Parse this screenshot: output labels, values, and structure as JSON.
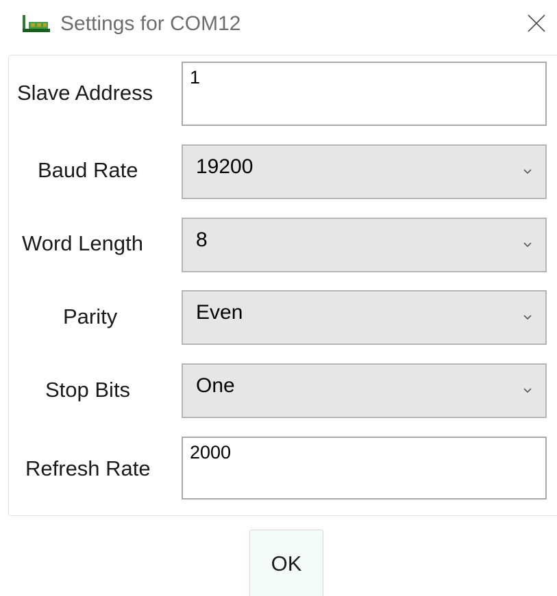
{
  "window": {
    "title": "Settings for COM12",
    "icon": "app-board-icon",
    "close_icon": "close-icon",
    "accent": "#2e7d32"
  },
  "fields": {
    "slave_address": {
      "label": "Slave Address",
      "value": "1"
    },
    "baud_rate": {
      "label": "Baud Rate",
      "value": "19200"
    },
    "word_length": {
      "label": "Word Length",
      "value": "8"
    },
    "parity": {
      "label": "Parity",
      "value": "Even"
    },
    "stop_bits": {
      "label": "Stop Bits",
      "value": "One"
    },
    "refresh_rate": {
      "label": "Refresh Rate",
      "value": "2000"
    }
  },
  "actions": {
    "ok_label": "OK"
  }
}
